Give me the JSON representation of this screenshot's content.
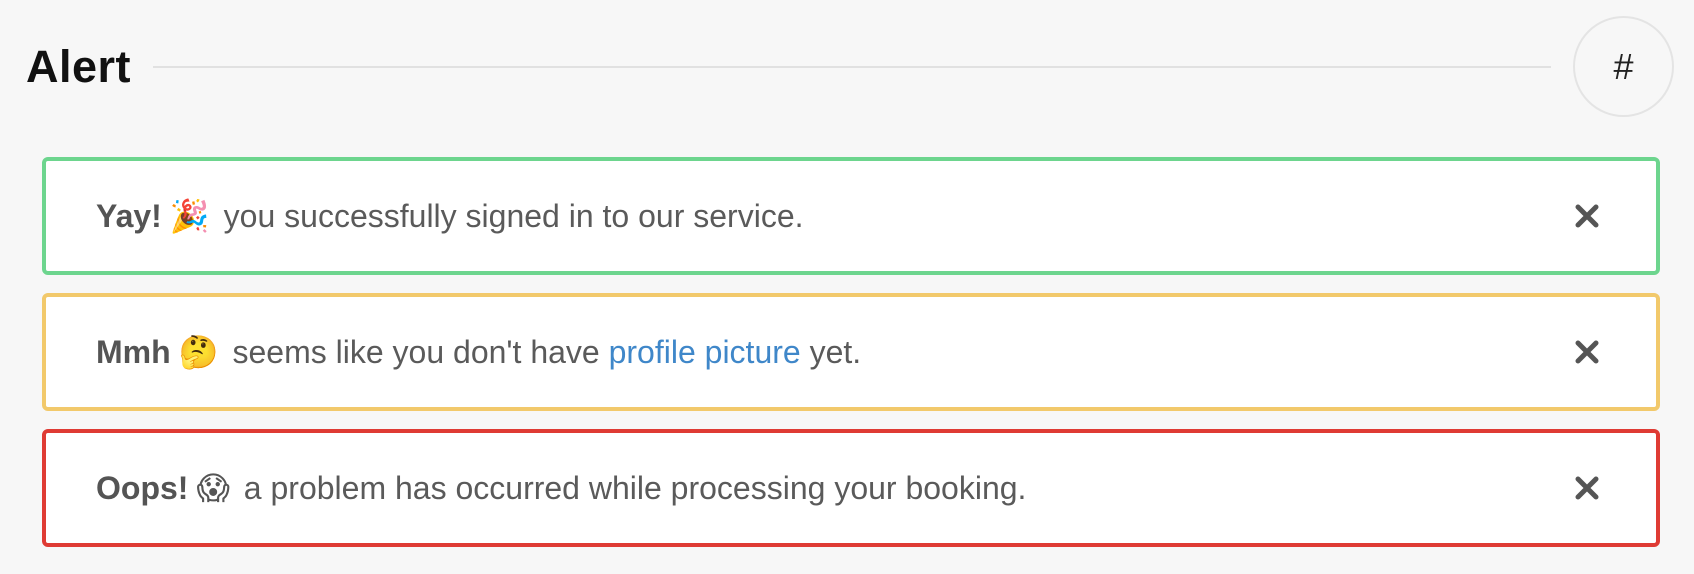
{
  "header": {
    "title": "Alert",
    "anchor_label": "#"
  },
  "alerts": [
    {
      "variant": "success",
      "border_color": "#6dd58e",
      "lead": "Yay!",
      "emoji": "🎉",
      "emoji_icon": "party-popper-icon",
      "message": "you successfully signed in to our service."
    },
    {
      "variant": "warning",
      "border_color": "#f2c96b",
      "lead": "Mmh",
      "emoji": "🤔",
      "emoji_icon": "thinking-face-icon",
      "message_before": "seems like you don't have",
      "link_text": "profile picture",
      "message_after": "yet."
    },
    {
      "variant": "danger",
      "border_color": "#df3b34",
      "lead": "Oops!",
      "emoji": "😱",
      "emoji_icon": "screaming-face-icon",
      "message": "a problem has occurred while processing your booking."
    }
  ],
  "close_icon": "close-icon",
  "colors": {
    "background": "#f7f7f7",
    "link": "#3f87c9",
    "text": "#555555"
  }
}
